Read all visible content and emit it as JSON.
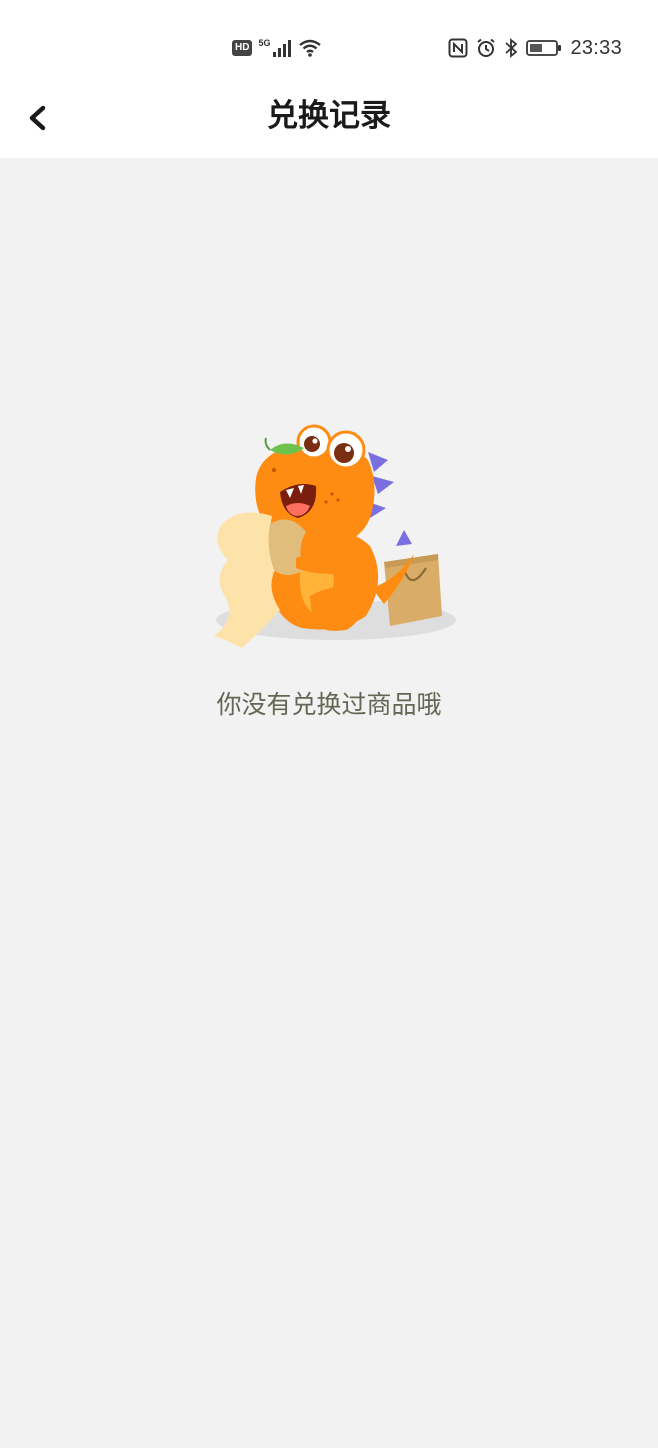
{
  "status_bar": {
    "hd_label": "HD",
    "network_label": "5G",
    "time": "23:33",
    "icons": [
      "hd-icon",
      "signal-icon",
      "wifi-icon",
      "nfc-icon",
      "alarm-icon",
      "bluetooth-icon",
      "battery-icon"
    ]
  },
  "nav": {
    "title": "兑换记录",
    "back_icon": "chevron-left-icon"
  },
  "empty_state": {
    "illustration": "orange-dinosaur-holding-receipt-with-shopping-bag",
    "message": "你没有兑换过商品哦"
  },
  "colors": {
    "background": "#f2f2f2",
    "header_bg": "#ffffff",
    "title_text": "#1a1a1a",
    "message_text": "#666655",
    "dino_orange": "#ff8c12",
    "dino_spikes": "#7b6fe0",
    "receipt": "#fde3aa",
    "bag": "#d9ad68"
  }
}
